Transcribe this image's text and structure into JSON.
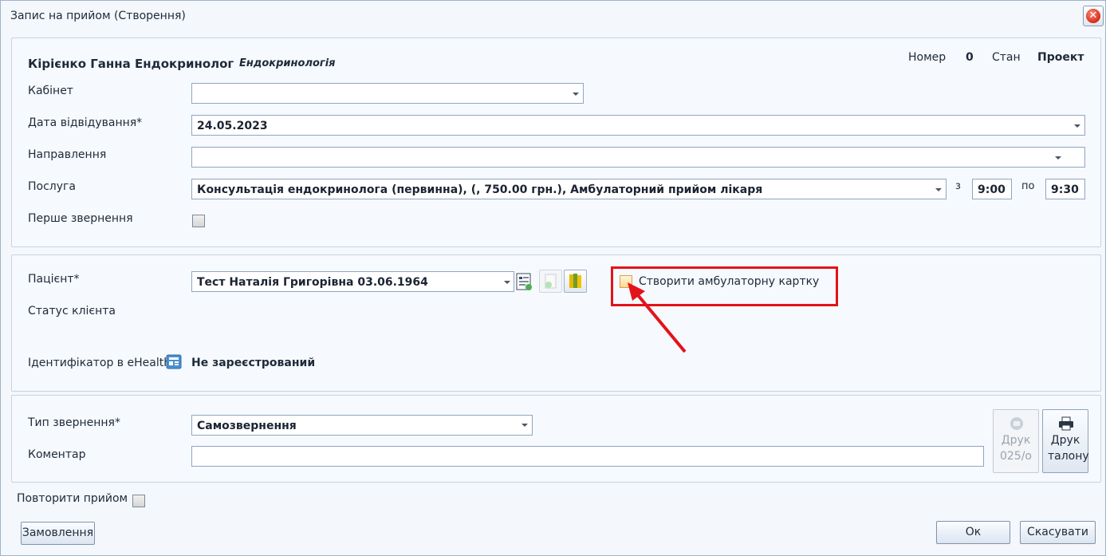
{
  "window": {
    "title": "Запис на прийом (Створення)",
    "close_icon": "close-icon"
  },
  "header": {
    "doctor": "Кірієнко Ганна Ендокринолог",
    "specialty": "Ендокринологія",
    "number_label": "Номер",
    "number_value": "0",
    "state_label": "Стан",
    "state_value": "Проект"
  },
  "form": {
    "cabinet_label": "Кабінет",
    "cabinet_value": "",
    "date_label": "Дата відвідування*",
    "date_value": "24.05.2023",
    "referral_label": "Направлення",
    "referral_value": "",
    "service_label": "Послуга",
    "service_value": "Консультація ендокринолога (первинна), (, 750.00 грн.), Амбулаторний прийом лікаря",
    "from_label": "з",
    "from_value": "9:00",
    "to_label": "по",
    "to_value": "9:30",
    "first_visit_label": "Перше звернення",
    "first_visit_checked": false
  },
  "patient": {
    "label": "Пацієнт*",
    "value": "Тест Наталія Григорівна 03.06.1964",
    "create_card_label": "Створити амбулаторну картку",
    "create_card_checked": false,
    "client_status_label": "Статус клієнта",
    "ehealth_label": "Ідентифікатор в eHealth",
    "ehealth_value": "Не зареєстрований"
  },
  "visit": {
    "type_label": "Тип звернення*",
    "type_value": "Самозвернення",
    "comment_label": "Коментар",
    "comment_value": "",
    "print_025_label": "Друк 025/о",
    "print_ticket_label": "Друк талону"
  },
  "footer": {
    "repeat_label": "Повторити прийом",
    "repeat_checked": false,
    "orders_button": "Замовлення",
    "ok_button": "Ок",
    "cancel_button": "Скасувати"
  },
  "colors": {
    "highlight": "#e3131b",
    "accent_border": "#8fa5c3"
  }
}
